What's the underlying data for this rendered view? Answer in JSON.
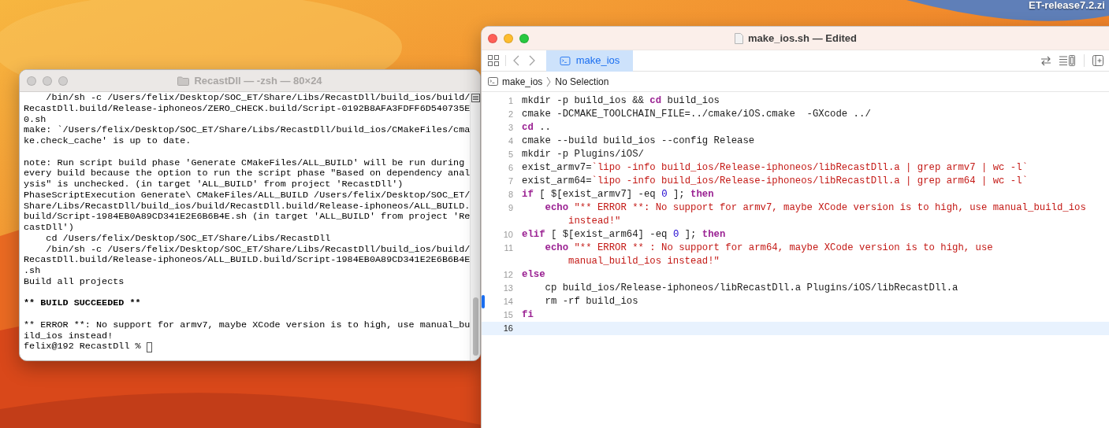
{
  "desktop": {
    "file_label": "ET-release7.2.zi"
  },
  "terminal": {
    "title": "RecastDll — -zsh — 80×24",
    "active": false,
    "lines": [
      {
        "kind": "text",
        "text": "    /bin/sh -c /Users/felix/Desktop/SOC_ET/Share/Libs/RecastDll/build_ios/build/"
      },
      {
        "kind": "text",
        "text": "RecastDll.build/Release-iphoneos/ZERO_CHECK.build/Script-0192B8AFA3FDFF6D540735E"
      },
      {
        "kind": "text",
        "text": "0.sh"
      },
      {
        "kind": "text",
        "text": "make: `/Users/felix/Desktop/SOC_ET/Share/Libs/RecastDll/build_ios/CMakeFiles/cma"
      },
      {
        "kind": "text",
        "text": "ke.check_cache' is up to date."
      },
      {
        "kind": "blank"
      },
      {
        "kind": "text",
        "text": "note: Run script build phase 'Generate CMakeFiles/ALL_BUILD' will be run during"
      },
      {
        "kind": "text",
        "text": "every build because the option to run the script phase \"Based on dependency anal"
      },
      {
        "kind": "text",
        "text": "ysis\" is unchecked. (in target 'ALL_BUILD' from project 'RecastDll')"
      },
      {
        "kind": "text",
        "text": "PhaseScriptExecution Generate\\ CMakeFiles/ALL_BUILD /Users/felix/Desktop/SOC_ET/"
      },
      {
        "kind": "text",
        "text": "Share/Libs/RecastDll/build_ios/build/RecastDll.build/Release-iphoneos/ALL_BUILD."
      },
      {
        "kind": "text",
        "text": "build/Script-1984EB0A89CD341E2E6B6B4E.sh (in target 'ALL_BUILD' from project 'Re"
      },
      {
        "kind": "text",
        "text": "castDll')"
      },
      {
        "kind": "text",
        "text": "    cd /Users/felix/Desktop/SOC_ET/Share/Libs/RecastDll"
      },
      {
        "kind": "text",
        "text": "    /bin/sh -c /Users/felix/Desktop/SOC_ET/Share/Libs/RecastDll/build_ios/build/"
      },
      {
        "kind": "text",
        "text": "RecastDll.build/Release-iphoneos/ALL_BUILD.build/Script-1984EB0A89CD341E2E6B6B4E"
      },
      {
        "kind": "text",
        "text": ".sh"
      },
      {
        "kind": "text",
        "text": "Build all projects"
      },
      {
        "kind": "blank"
      },
      {
        "kind": "bold",
        "text": "** BUILD SUCCEEDED **"
      },
      {
        "kind": "blank"
      },
      {
        "kind": "text",
        "text": "** ERROR **: No support for armv7, maybe XCode version is to high, use manual_bu"
      },
      {
        "kind": "text",
        "text": "ild_ios instead!"
      },
      {
        "kind": "prompt",
        "text": "felix@192 RecastDll % "
      }
    ]
  },
  "editor": {
    "title": "make_ios.sh — Edited",
    "active": true,
    "tabs": [
      {
        "label": "make_ios",
        "selected": true
      }
    ],
    "breadcrumb": {
      "file": "make_ios",
      "selection": "No Selection"
    },
    "lines": [
      {
        "number": "1",
        "indented": false,
        "changed": false,
        "current": false,
        "tokens": [
          {
            "kind": "plain",
            "text": "mkdir -p build_ios && "
          },
          {
            "kind": "keyword",
            "text": "cd"
          },
          {
            "kind": "plain",
            "text": " build_ios"
          }
        ]
      },
      {
        "number": "2",
        "indented": false,
        "changed": false,
        "current": false,
        "tokens": [
          {
            "kind": "plain",
            "text": "cmake -DCMAKE_TOOLCHAIN_FILE=../cmake/iOS.cmake  -GXcode ../"
          }
        ]
      },
      {
        "number": "3",
        "indented": false,
        "changed": false,
        "current": false,
        "tokens": [
          {
            "kind": "keyword",
            "text": "cd"
          },
          {
            "kind": "plain",
            "text": " .."
          }
        ]
      },
      {
        "number": "4",
        "indented": false,
        "changed": false,
        "current": false,
        "tokens": [
          {
            "kind": "plain",
            "text": "cmake --build build_ios --config Release"
          }
        ]
      },
      {
        "number": "5",
        "indented": false,
        "changed": false,
        "current": false,
        "tokens": [
          {
            "kind": "plain",
            "text": "mkdir -p Plugins/iOS/"
          }
        ]
      },
      {
        "number": "6",
        "indented": false,
        "changed": false,
        "current": false,
        "tokens": [
          {
            "kind": "plain",
            "text": "exist_armv7="
          },
          {
            "kind": "string",
            "text": "`lipo -info build_ios/Release-iphoneos/libRecastDll.a | grep armv7 | wc -l`"
          }
        ]
      },
      {
        "number": "7",
        "indented": false,
        "changed": false,
        "current": false,
        "tokens": [
          {
            "kind": "plain",
            "text": "exist_arm64="
          },
          {
            "kind": "string",
            "text": "`lipo -info build_ios/Release-iphoneos/libRecastDll.a | grep arm64 | wc -l`"
          }
        ]
      },
      {
        "number": "8",
        "indented": false,
        "changed": false,
        "current": false,
        "tokens": [
          {
            "kind": "keyword",
            "text": "if"
          },
          {
            "kind": "plain",
            "text": " [ $[exist_armv7] -eq "
          },
          {
            "kind": "number",
            "text": "0"
          },
          {
            "kind": "plain",
            "text": " ]; "
          },
          {
            "kind": "keyword",
            "text": "then"
          }
        ]
      },
      {
        "number": "9",
        "indented": true,
        "changed": false,
        "current": false,
        "tokens": [
          {
            "kind": "keyword",
            "text": "echo"
          },
          {
            "kind": "string",
            "text": " \"** ERROR **: No support for armv7, maybe XCode version is to high, use manual_build_ios"
          }
        ],
        "wrap": [
          {
            "kind": "string",
            "text": "instead!\""
          }
        ]
      },
      {
        "number": "10",
        "indented": false,
        "changed": false,
        "current": false,
        "tokens": [
          {
            "kind": "keyword",
            "text": "elif"
          },
          {
            "kind": "plain",
            "text": " [ $[exist_arm64] -eq "
          },
          {
            "kind": "number",
            "text": "0"
          },
          {
            "kind": "plain",
            "text": " ]; "
          },
          {
            "kind": "keyword",
            "text": "then"
          }
        ]
      },
      {
        "number": "11",
        "indented": true,
        "changed": false,
        "current": false,
        "tokens": [
          {
            "kind": "keyword",
            "text": "echo"
          },
          {
            "kind": "string",
            "text": " \"** ERROR ** : No support for arm64, maybe XCode version is to high, use"
          }
        ],
        "wrap": [
          {
            "kind": "string",
            "text": "manual_build_ios instead!\""
          }
        ]
      },
      {
        "number": "12",
        "indented": false,
        "changed": false,
        "current": false,
        "tokens": [
          {
            "kind": "keyword",
            "text": "else"
          }
        ]
      },
      {
        "number": "13",
        "indented": true,
        "changed": false,
        "current": false,
        "tokens": [
          {
            "kind": "plain",
            "text": "cp build_ios/Release-iphoneos/libRecastDll.a Plugins/iOS/libRecastDll.a"
          }
        ]
      },
      {
        "number": "14",
        "indented": true,
        "changed": true,
        "current": false,
        "tokens": [
          {
            "kind": "plain",
            "text": "rm -rf build_ios"
          }
        ]
      },
      {
        "number": "15",
        "indented": false,
        "changed": false,
        "current": false,
        "tokens": [
          {
            "kind": "keyword",
            "text": "fi"
          }
        ]
      },
      {
        "number": "16",
        "changed": false,
        "current": true
      }
    ]
  }
}
